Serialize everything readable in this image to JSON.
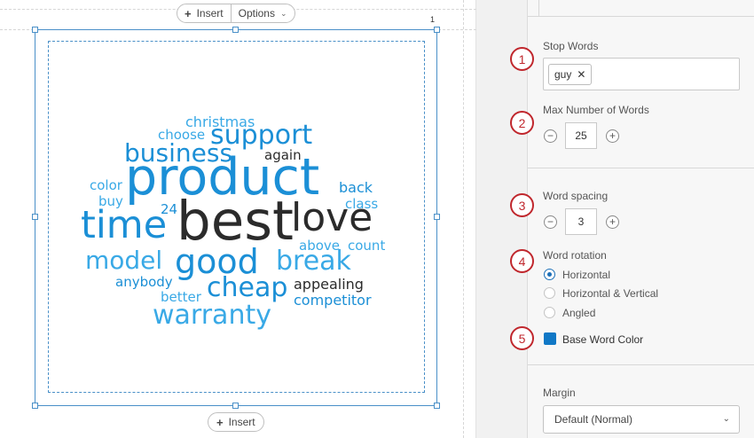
{
  "toolbar": {
    "insert_label": "Insert",
    "options_label": "Options",
    "insert_bottom_label": "Insert",
    "page_number": "1"
  },
  "wordcloud": {
    "colors": {
      "dark": "#2b2b2b",
      "blue": "#1b8fd6",
      "light": "#39a9e6"
    },
    "words": [
      {
        "text": "christmas",
        "color": "light"
      },
      {
        "text": "choose",
        "color": "light"
      },
      {
        "text": "support",
        "color": "blue"
      },
      {
        "text": "business",
        "color": "blue"
      },
      {
        "text": "again",
        "color": "dark"
      },
      {
        "text": "product",
        "color": "blue"
      },
      {
        "text": "color",
        "color": "light"
      },
      {
        "text": "back",
        "color": "blue"
      },
      {
        "text": "buy",
        "color": "light"
      },
      {
        "text": "class",
        "color": "light"
      },
      {
        "text": "24",
        "color": "blue"
      },
      {
        "text": "time",
        "color": "blue"
      },
      {
        "text": "best",
        "color": "dark"
      },
      {
        "text": "love",
        "color": "dark"
      },
      {
        "text": "above",
        "color": "light"
      },
      {
        "text": "count",
        "color": "light"
      },
      {
        "text": "model",
        "color": "light"
      },
      {
        "text": "good",
        "color": "blue"
      },
      {
        "text": "break",
        "color": "light"
      },
      {
        "text": "anybody",
        "color": "blue"
      },
      {
        "text": "cheap",
        "color": "blue"
      },
      {
        "text": "appealing",
        "color": "dark"
      },
      {
        "text": "better",
        "color": "light"
      },
      {
        "text": "competitor",
        "color": "blue"
      },
      {
        "text": "warranty",
        "color": "light"
      }
    ]
  },
  "panel": {
    "stop_words": {
      "label": "Stop Words",
      "tags": [
        "guy"
      ]
    },
    "max_words": {
      "label": "Max Number of Words",
      "value": "25"
    },
    "word_spacing": {
      "label": "Word spacing",
      "value": "3"
    },
    "word_rotation": {
      "label": "Word rotation",
      "options": [
        "Horizontal",
        "Horizontal & Vertical",
        "Angled"
      ],
      "selected": "Horizontal"
    },
    "base_color": {
      "label": "Base Word Color",
      "color": "#1078c6"
    },
    "margin": {
      "label": "Margin",
      "value": "Default (Normal)"
    }
  },
  "callouts": [
    "1",
    "2",
    "3",
    "4",
    "5"
  ]
}
